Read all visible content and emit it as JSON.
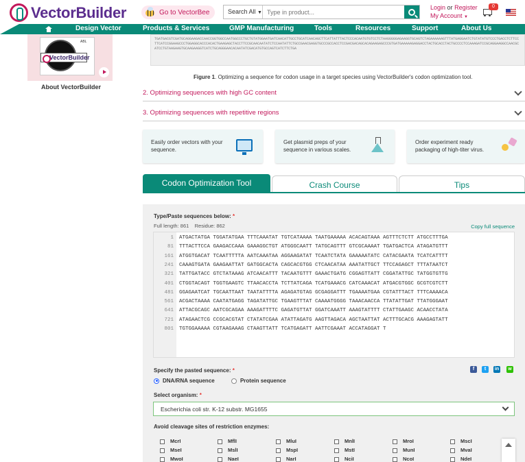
{
  "header": {
    "logo_text": "VectorBuilder",
    "bee_label": "Go to VectorBee",
    "search": {
      "scope": "Search All",
      "placeholder": "Type in product..."
    },
    "login": "Login",
    "or": "or",
    "register": "Register",
    "my_account": "My Account",
    "cart_count": "0",
    "icons": [
      "vectorbuilder-logo-icon",
      "bee-icon",
      "chevron-down-icon",
      "search-icon",
      "cart-icon",
      "us-flag-icon",
      "home-icon"
    ]
  },
  "nav": [
    "Design Vector",
    "Products & Services",
    "GMP Manufacturing",
    "Tools",
    "Resources",
    "Support",
    "About Us"
  ],
  "sidebar": {
    "video_logo": "VectorBuilder",
    "video_tag": "ABL",
    "about": "About VectorBuilder"
  },
  "figure": {
    "preview": "TGATGACGTCGATGCAGGAAGACCAACCGGTGGCCAATGGCCCTGCTGTATGGAATGATCAACATTGCCTGCATCAACAGCTTCATTATTTACTCCCACAATGTGTCCTCTAAGGGGGAGAAGGTGCAGTCTAGAAAAAAGTTTATGAGGAATCTGTATATGTCCCTGACCTCTTCCTTCATCCGGAAGCCCTGGAGGCACCCACACTGAAGAGCTACCTTCCGCAACAATATCTCCAATATTCTGCCGAACGAGGTGCCCGCCACCTCCGACGACAGCACAGAAGAGCCCGTGATGAAAAAGAGGACCTACTGCACCTACTGCCCCTCCAAAGATCCGCAGGAAGGCCAACGCATCCTGTAAGAAGTGCAAGAAGGTCATCTGCAGGGAACACAATATCGACATGTGCCAGTCATCTTCTGA",
    "caption_bold": "Figure 1",
    "caption": ". Optimizing a sequence for codon usage in a target species using VectorBuilder's codon optimization tool."
  },
  "accordions": [
    "2. Optimizing sequences with high GC content",
    "3. Optimizing sequences with repetitive regions"
  ],
  "promos": [
    {
      "text": "Easily order vectors with your sequence.",
      "icon": "monitor-icon"
    },
    {
      "text": "Get plasmid preps of your sequence in various scales.",
      "icon": "flask-icon"
    },
    {
      "text": "Order experiment ready packaging of high-titer virus.",
      "icon": "virus-icon"
    }
  ],
  "tabs": [
    "Codon Optimization Tool",
    "Crash Course",
    "Tips"
  ],
  "tool": {
    "paste_label": "Type/Paste sequences below:",
    "req": "*",
    "full_length_label": "Full length:",
    "full_length": "861",
    "residue_label": "Residue:",
    "residue": "862",
    "copy_link": "Copy full sequence",
    "sequence_lines": [
      {
        "n": "1",
        "s": "ATGACTATGA TGGATATGAA TTTCAAATAT TGTCATAAAA TAATGAAAAA ACACAGTAAA AGTTTCTCTT ATGCCTTTGA"
      },
      {
        "n": "81",
        "s": "TTTACTTCCA GAAGACCAAA GAAAGGCTGT ATGGGCAATT TATGCAGTTT GTCGCAAAAT TGATGACTCA ATAGATGTTT"
      },
      {
        "n": "161",
        "s": "ATGGTGACAT TCAATTTTTA AATCAAATAA AGGAAGATAT TCAATCTATA GAAAAATATC CATACGAATA TCATCATTTT"
      },
      {
        "n": "241",
        "s": "CAAAGTGATA GAAGAATTAT GATGGCACTA CAGCACGTGG CTCAACATAA AAATATTGCT TTCCAGAGCT TTTATAATCT"
      },
      {
        "n": "321",
        "s": "TATTGATACC GTCTATAAAG ATCAACATTT TACAATGTTT GAAACTGATG CGGAGTTATT CGGATATTGC TATGGTGTTG"
      },
      {
        "n": "401",
        "s": "CTGGTACAGT TGGTGAAGTC TTAACACCTA TCTTATCAGA TCATGAAACG CATCAAACAT ATGACGTGGC GCGTCGTCTT"
      },
      {
        "n": "481",
        "s": "GGAGAATCAT TGCAATTAAT TAATATTTTA AGAGATGTAG GCGAGGATTT TGAAAATGAA CGTATTTACT TTTCAAAACA"
      },
      {
        "n": "561",
        "s": "ACGACTAAAA CAATATGAGG TAGATATTGC TGAAGTTTAT CAAAATGGGG TAAACAACCA TTATATTGAT TTATGGGAAT"
      },
      {
        "n": "641",
        "s": "ATTACGCAGC AATCGCAGAA AAAGATTTTC GAGATGTTAT GGATCAAATT AAAGTATTTT CTATTGAAGC ACAACCTATA"
      },
      {
        "n": "721",
        "s": "ATAGAACTCG CCGCACGTAT CTATATCGAA ATATTAGATG AAGTTAGACA AGCTAATTAT ACTTTGCACG AAAGAGTATT"
      },
      {
        "n": "801",
        "s": "TGTGGAAAAA CGTAAGAAAG CTAAGTTATT TCATGAGATT AATTCGAAAT ACCATAGGAT T"
      }
    ],
    "specify_label": "Specify the pasted sequence:",
    "radio_dna": "DNA/RNA sequence",
    "radio_protein": "Protein sequence",
    "organism_label": "Select organism:",
    "organism_value": "Escherichia coli str. K-12 substr. MG1655",
    "enzymes_label": "Avoid cleavage sites of restriction enzymes:",
    "enzymes": [
      [
        "McrI",
        "MflI",
        "MluI",
        "MnlI",
        "MroI",
        "MscI"
      ],
      [
        "MseI",
        "MslI",
        "MspI",
        "MstI",
        "MunI",
        "MvaI"
      ],
      [
        "MwoI",
        "NaeI",
        "NarI",
        "NciI",
        "NcoI",
        "NdeI"
      ]
    ],
    "social": [
      {
        "icon": "facebook-icon",
        "glyph": "f",
        "color": "#3b5998"
      },
      {
        "icon": "twitter-icon",
        "glyph": "t",
        "color": "#1da1f2"
      },
      {
        "icon": "linkedin-icon",
        "glyph": "in",
        "color": "#0077b5"
      },
      {
        "icon": "wechat-icon",
        "glyph": "w",
        "color": "#2dc100"
      }
    ]
  },
  "colors": {
    "teal": "#0a8a78",
    "magenta": "#c2185b",
    "purple": "#5b2d8e"
  }
}
